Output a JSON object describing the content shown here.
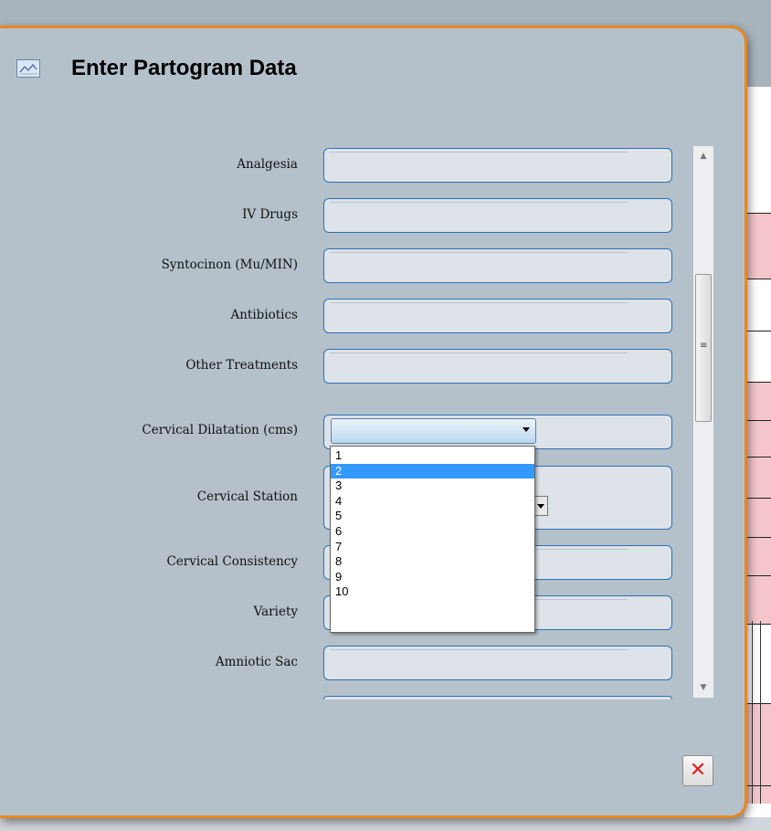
{
  "dialog": {
    "title": "Enter Partogram Data",
    "icon": "chart-icon",
    "close_icon": "close-icon"
  },
  "fields": [
    {
      "label": "Analgesia",
      "value": ""
    },
    {
      "label": "IV Drugs",
      "value": ""
    },
    {
      "label": "Syntocinon (Mu/MIN)",
      "value": ""
    },
    {
      "label": "Antibiotics",
      "value": ""
    },
    {
      "label": "Other Treatments",
      "value": ""
    },
    {
      "label": "Cervical Dilatation (cms)",
      "value": ""
    },
    {
      "label": "Cervical Station",
      "value": ""
    },
    {
      "label": "Cervical Consistency",
      "value": ""
    },
    {
      "label": "Variety",
      "value": ""
    },
    {
      "label": "Amniotic Sac",
      "value": ""
    }
  ],
  "dilatation_dropdown": {
    "selected": "2",
    "options": [
      "1",
      "2",
      "3",
      "4",
      "5",
      "6",
      "7",
      "8",
      "9",
      "10"
    ]
  },
  "scrollbar": {
    "grip_glyph": "≡",
    "up_glyph": "▲",
    "down_glyph": "▼"
  },
  "colors": {
    "border_accent": "#e8871f",
    "field_border": "#2f6fb5",
    "selected_option": "#3399ff",
    "close_x": "#e0201d"
  }
}
